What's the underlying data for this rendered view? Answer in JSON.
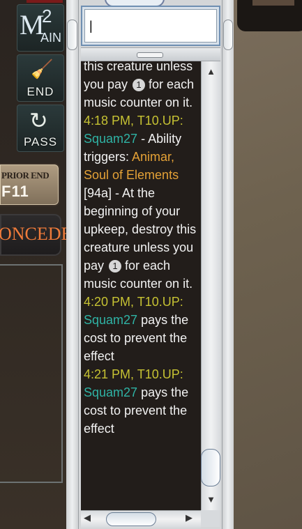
{
  "phase_buttons": {
    "main2": {
      "big": "M",
      "sup": "2",
      "rest": "AIN"
    },
    "end": {
      "label": "END",
      "icon": "broom-icon"
    },
    "pass": {
      "label": "PASS",
      "icon": "arrow-icon"
    }
  },
  "prior_end": {
    "line1": "PRIOR END",
    "line2": "F11"
  },
  "concede": {
    "label": "ONCEDE"
  },
  "chat": {
    "input_value": "|",
    "segments": [
      {
        "type": "text",
        "text": "this creature unless you pay "
      },
      {
        "type": "mana",
        "text": "1"
      },
      {
        "type": "text",
        "text": " for each music counter on it."
      },
      {
        "type": "break"
      },
      {
        "type": "time",
        "text": "4:18 PM, T10.UP:"
      },
      {
        "type": "break"
      },
      {
        "type": "player",
        "text": "Squam27"
      },
      {
        "type": "text",
        "text": " - Ability triggers: "
      },
      {
        "type": "card",
        "text": "Animar, Soul of Elements"
      },
      {
        "type": "text",
        "text": " [94a] - At the beginning of your upkeep, destroy this creature unless you pay "
      },
      {
        "type": "mana",
        "text": "1"
      },
      {
        "type": "text",
        "text": " for each music counter on it."
      },
      {
        "type": "break"
      },
      {
        "type": "time",
        "text": "4:20 PM, T10.UP:"
      },
      {
        "type": "break"
      },
      {
        "type": "player",
        "text": "Squam27"
      },
      {
        "type": "text",
        "text": " pays the cost to prevent the effect"
      },
      {
        "type": "break"
      },
      {
        "type": "time",
        "text": "4:21 PM, T10.UP:"
      },
      {
        "type": "break"
      },
      {
        "type": "player",
        "text": "Squam27"
      },
      {
        "type": "text",
        "text": " pays the cost to prevent the effect"
      }
    ]
  },
  "scroll": {
    "up": "▲",
    "down": "▼",
    "left": "◀",
    "right": "▶"
  }
}
